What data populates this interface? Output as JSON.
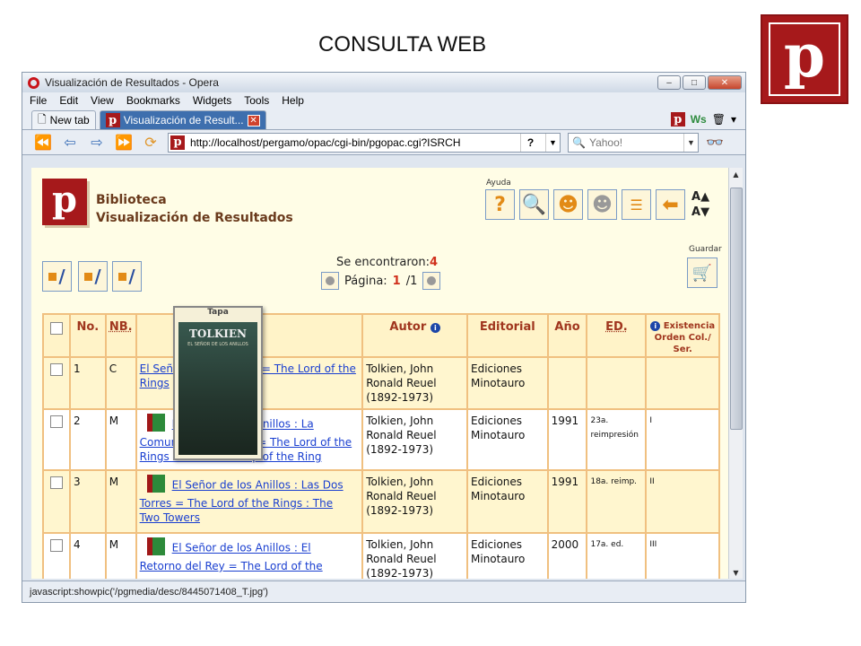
{
  "slide": {
    "title": "CONSULTA WEB",
    "logo_letter": "p"
  },
  "browser": {
    "window_title": "Visualización de Resultados - Opera",
    "menu": [
      "File",
      "Edit",
      "View",
      "Bookmarks",
      "Widgets",
      "Tools",
      "Help"
    ],
    "tabs": [
      {
        "label": "New tab"
      },
      {
        "label": "Visualización de Result..."
      }
    ],
    "address": "http://localhost/pergamo/opac/cgi-bin/pgopac.cgi?ISRCH",
    "search_placeholder": "Yahoo!",
    "status": "javascript:showpic('/pgmedia/desc/8445071408_T.jpg')"
  },
  "page": {
    "logo_letter": "p",
    "title_line1": "Biblioteca",
    "title_line2": "Visualización de Resultados",
    "ayuda_label": "Ayuda",
    "guardar_label": "Guardar",
    "found_label": "Se encontraron:",
    "found_count": "4",
    "page_label": "Página:",
    "page_current": "1",
    "page_total": "/1",
    "font_bigger": "A",
    "font_smaller": "A"
  },
  "table": {
    "headers": {
      "no": "No.",
      "nb": "NB.",
      "autor": "Autor",
      "editorial": "Editorial",
      "anio": "Año",
      "ed": "ED.",
      "existencia": "Existencia",
      "orden": "Orden Col./ Ser."
    },
    "rows": [
      {
        "no": "1",
        "nb": "C",
        "title": "El Señor de los Anillos = The Lord of the Rings",
        "title_visible_a": "El Seño",
        "title_visible_b": "= The Lord of",
        "title_visible_c": "the Rin",
        "autor": "Tolkien, John Ronald Reuel (1892-1973)",
        "editorial": "Ediciones Minotauro",
        "anio": "",
        "ed": "",
        "orden": ""
      },
      {
        "no": "2",
        "nb": "M",
        "title_a": "El Señor de los Anillos : La",
        "title_b": "Comunidad del Anillo = The Lord of the",
        "title_c": "Rings : The Fellowship of the Ring",
        "autor": "Tolkien, John Ronald Reuel (1892-1973)",
        "editorial": "Ediciones Minotauro",
        "anio": "1991",
        "ed": "23a. reimpresión",
        "orden": "I"
      },
      {
        "no": "3",
        "nb": "M",
        "title_a": "El Señor de los Anillos : Las Dos",
        "title_b": "Torres = The Lord of the Rings : The",
        "title_c": "Two Towers",
        "autor": "Tolkien, John Ronald Reuel (1892-1973)",
        "editorial": "Ediciones Minotauro",
        "anio": "1991",
        "ed": "18a. reimp.",
        "orden": "II"
      },
      {
        "no": "4",
        "nb": "M",
        "title_a": "El Señor de los Anillos : El",
        "title_b": "Retorno del Rey = The Lord of the",
        "title_c": "",
        "autor": "Tolkien, John Ronald Reuel (1892-1973)",
        "editorial": "Ediciones Minotauro",
        "anio": "2000",
        "ed": "17a. ed.",
        "orden": "III"
      }
    ]
  },
  "popup": {
    "label": "Tapa",
    "cover_author": "TOLKIEN",
    "cover_sub": "EL SEÑOR DE LOS ANILLOS"
  }
}
